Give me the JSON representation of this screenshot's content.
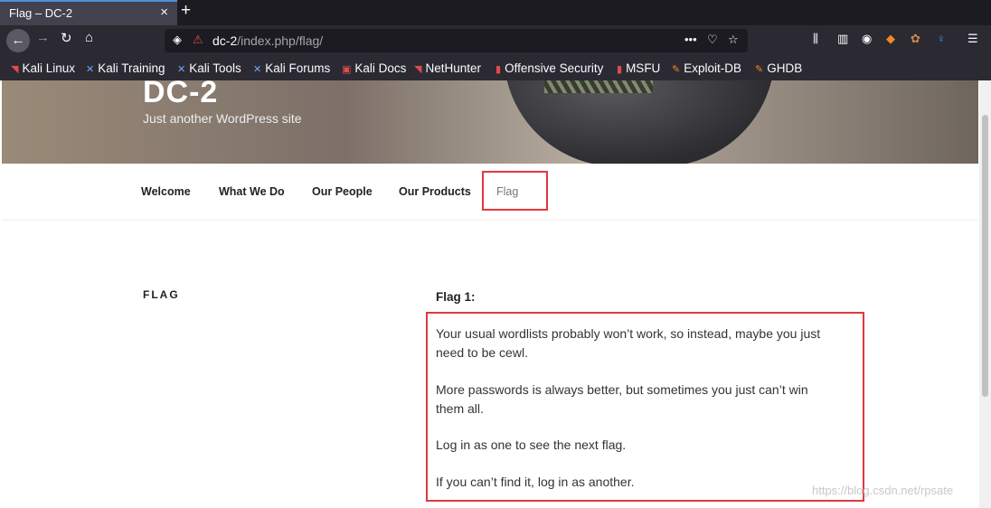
{
  "browser": {
    "tab_title": "Flag – DC-2",
    "tab_close": "×",
    "new_tab": "+",
    "url_host": "dc-2",
    "url_path": "/index.php/flag/",
    "url_more": "•••"
  },
  "bookmarks": [
    {
      "label": "Kali Linux"
    },
    {
      "label": "Kali Training"
    },
    {
      "label": "Kali Tools"
    },
    {
      "label": "Kali Forums"
    },
    {
      "label": "Kali Docs"
    },
    {
      "label": "NetHunter"
    },
    {
      "label": "Offensive Security"
    },
    {
      "label": "MSFU"
    },
    {
      "label": "Exploit-DB"
    },
    {
      "label": "GHDB"
    }
  ],
  "site": {
    "title": "DC-2",
    "tagline": "Just another WordPress site"
  },
  "menu": {
    "items": [
      {
        "label": "Welcome"
      },
      {
        "label": "What We Do"
      },
      {
        "label": "Our People"
      },
      {
        "label": "Our Products"
      },
      {
        "label": "Flag"
      }
    ]
  },
  "content": {
    "page_title": "FLAG",
    "flag_heading": "Flag 1:",
    "paragraphs": [
      "Your usual wordlists probably won’t work, so instead, maybe you just need to be cewl.",
      "More passwords is always better, but sometimes you just can’t win them all.",
      "Log in as one to see the next flag.",
      "If you can’t find it, log in as another."
    ]
  },
  "watermark": "https://blog.csdn.net/rpsate",
  "colors": {
    "highlight": "#e0393e",
    "accent": "#4a90d9"
  }
}
